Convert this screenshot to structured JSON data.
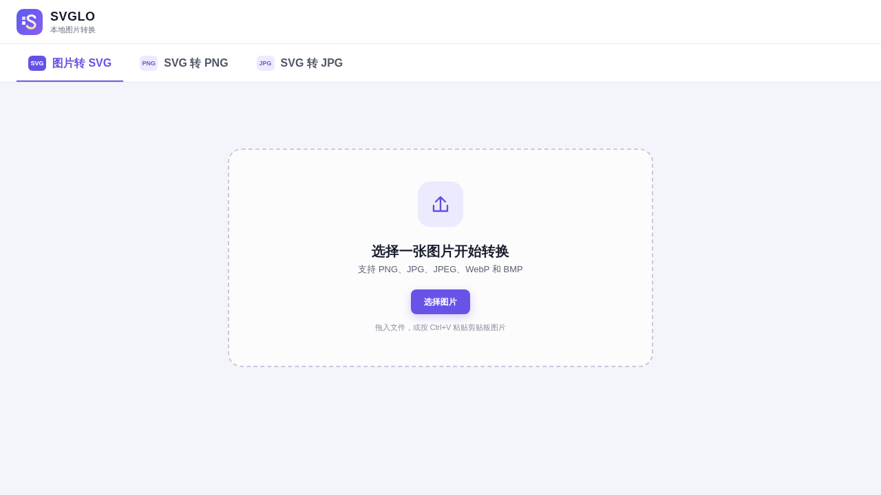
{
  "app": {
    "name": "SVGLO",
    "tagline": "本地图片转换"
  },
  "tabs": [
    {
      "badge": "SVG",
      "label": "图片转 SVG",
      "selected": true
    },
    {
      "badge": "PNG",
      "label": "SVG 转 PNG",
      "selected": false
    },
    {
      "badge": "JPG",
      "label": "SVG 转 JPG",
      "selected": false
    }
  ],
  "upload": {
    "title": "选择一张图片开始转换",
    "formats": "支持 PNG、JPG、JPEG、WebP 和 BMP",
    "button": "选择图片",
    "hint": "拖入文件，或按 Ctrl+V 粘贴剪贴板图片"
  }
}
